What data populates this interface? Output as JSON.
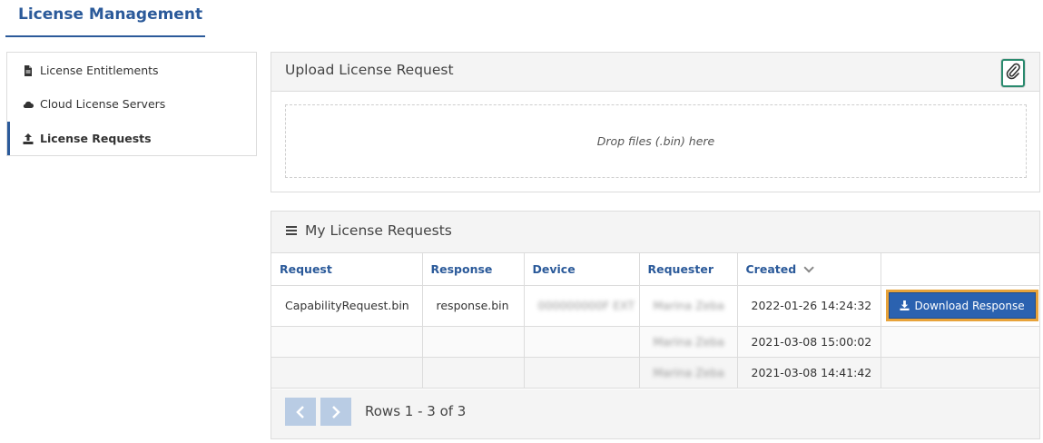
{
  "header": {
    "title": "License Management"
  },
  "sidebar": {
    "items": [
      {
        "label": "License Entitlements",
        "icon": "document-icon"
      },
      {
        "label": "Cloud License Servers",
        "icon": "cloud-icon"
      },
      {
        "label": "License Requests",
        "icon": "upload-icon",
        "active": true
      }
    ]
  },
  "upload": {
    "title": "Upload License Request",
    "dropzone_text": "Drop files (.bin) here",
    "attach_icon": "paperclip-icon"
  },
  "requests": {
    "title": "My License Requests",
    "columns": [
      "Request",
      "Response",
      "Device",
      "Requester",
      "Created"
    ],
    "sort_column": "Created",
    "rows": [
      {
        "request": "CapabilityRequest.bin",
        "response": "response.bin",
        "device": "000000000F EXT",
        "requester": "Marina Zeba",
        "created": "2022-01-26 14:24:32",
        "action": "Download Response"
      },
      {
        "request": "",
        "response": "",
        "device": "",
        "requester": "Marina Zeba",
        "created": "2021-03-08 15:00:02",
        "action": ""
      },
      {
        "request": "",
        "response": "",
        "device": "",
        "requester": "Marina Zeba",
        "created": "2021-03-08 14:41:42",
        "action": ""
      }
    ],
    "pager_text": "Rows 1 - 3 of 3"
  },
  "colors": {
    "accent": "#2b5a9a",
    "button": "#2b62b0",
    "focus": "#e8a33a",
    "attach_border": "#2a8a6e"
  }
}
